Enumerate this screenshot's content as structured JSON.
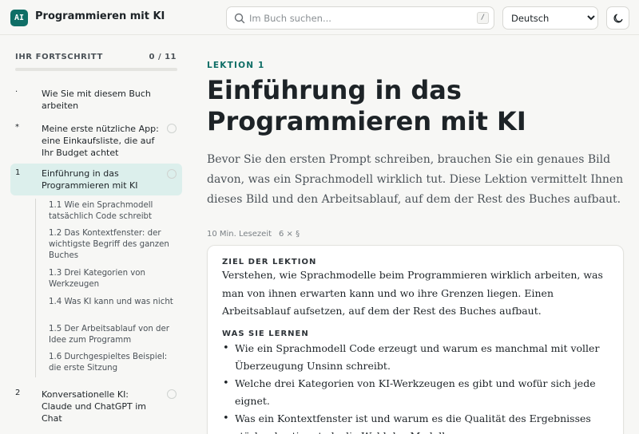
{
  "app": {
    "logo": "AI",
    "title": "Programmieren mit KI"
  },
  "search": {
    "placeholder": "Im Buch suchen...",
    "shortcut": "/"
  },
  "language": {
    "selected": "Deutsch"
  },
  "sidebar": {
    "progress_label": "IHR FORTSCHRITT",
    "progress_count": "0 / 11",
    "progress_fraction": 0,
    "items": [
      {
        "marker": "·",
        "label": "Wie Sie mit diesem Buch arbeiten"
      },
      {
        "marker": "*",
        "label": "Meine erste nützliche App: eine Einkaufsliste, die auf Ihr Budget achtet"
      },
      {
        "marker": "1",
        "label": "Einführung in das Programmieren mit KI"
      },
      {
        "marker": "2",
        "label": "Konversationelle KI: Claude und ChatGPT im Chat"
      }
    ],
    "subitems": [
      {
        "label": "1.1  Wie ein Sprachmodell tatsächlich Code schreibt"
      },
      {
        "label": "1.2  Das Kontextfenster: der wichtigste Begriff des ganzen Buches"
      },
      {
        "label": "1.3  Drei Kategorien von Werkzeugen"
      },
      {
        "label": "1.4  Was KI kann und was nicht"
      },
      {
        "label": "1.5  Der Arbeitsablauf von der Idee zum Programm"
      },
      {
        "label": "1.6  Durchgespieltes Beispiel: die erste Sitzung"
      }
    ]
  },
  "lesson": {
    "kicker": "LEKTION 1",
    "title": "Einführung in das Programmieren mit KI",
    "intro": "Bevor Sie den ersten Prompt schreiben, brauchen Sie ein genaues Bild davon, was ein Sprachmodell wirklich tut. Diese Lektion vermittelt Ihnen dieses Bild und den Arbeitsablauf, auf dem der Rest des Buches aufbaut.",
    "reading_time": "10 Min. Lesezeit",
    "sections": "6 × §"
  },
  "goals": {
    "goal_heading": "ZIEL DER LEKTION",
    "goal_text": "Verstehen, wie Sprachmodelle beim Programmieren wirklich arbeiten, was man von ihnen erwarten kann und wo ihre Grenzen liegen. Einen Arbeitsablauf aufsetzen, auf dem der Rest des Buches aufbaut.",
    "learn_heading": "WAS SIE LERNEN",
    "learn_items": [
      "Wie ein Sprachmodell Code erzeugt und warum es manchmal mit voller Überzeugung Unsinn schreibt.",
      "Welche drei Kategorien von KI-Werkzeugen es gibt und wofür sich jede eignet.",
      "Was ein Kontextfenster ist und warum es die Qualität des Ergebnisses stärker bestimmt als die Wahl des Modells."
    ]
  }
}
